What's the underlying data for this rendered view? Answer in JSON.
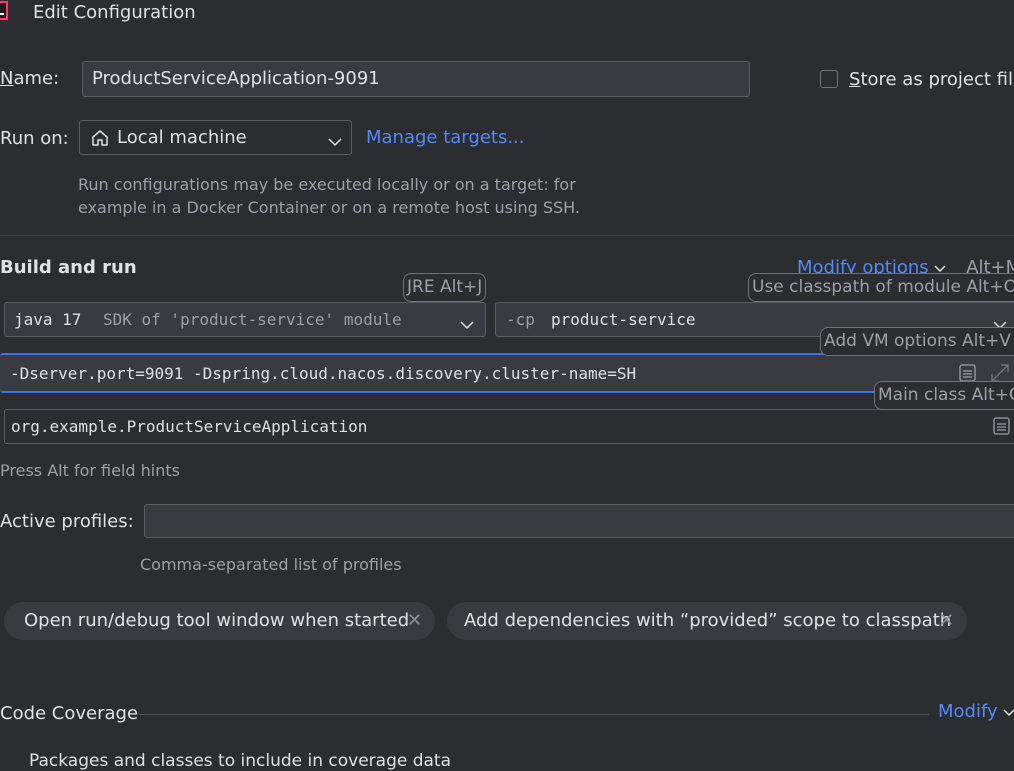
{
  "window": {
    "title": "Edit Configuration",
    "app_icon": "intellij-icon"
  },
  "name_row": {
    "label_mnemonic": "N",
    "label_rest": "ame:",
    "value": "ProductServiceApplication-9091"
  },
  "store_project": {
    "label_mnemonic": "S",
    "label_rest": "tore as project file",
    "checked": false
  },
  "run_on": {
    "label": "Run on:",
    "target": "Local machine",
    "target_icon": "home-icon",
    "manage_link": "Manage targets..."
  },
  "run_on_help": {
    "line1": "Run configurations may be executed locally or on a target: for",
    "line2": "example in a Docker Container or on a remote host using SSH."
  },
  "build_run": {
    "header": "Build and run",
    "modify_options": "Modify options",
    "modify_options_shortcut": "Alt+M",
    "jre_hint": "JRE Alt+J",
    "classpath_hint": "Use classpath of module Alt+O",
    "vm_hint": "Add VM options Alt+V",
    "main_class_hint": "Main class Alt+C",
    "jre": {
      "version": "java 17",
      "desc": "SDK of 'product-service' module"
    },
    "classpath": {
      "flag": "-cp",
      "module": "product-service"
    },
    "vm_options": "-Dserver.port=9091 -Dspring.cloud.nacos.discovery.cluster-name=SH",
    "main_class": "org.example.ProductServiceApplication",
    "field_hint": "Press Alt for field hints"
  },
  "profiles": {
    "label": "Active profiles:",
    "value": "",
    "help": "Comma-separated list of profiles"
  },
  "chips": [
    {
      "label": "Open run/debug tool window when started"
    },
    {
      "label": "Add dependencies with “provided” scope to classpath"
    }
  ],
  "code_coverage": {
    "label": "Code Coverage",
    "modify": "Modify",
    "subtext": "Packages and classes to include in coverage data"
  },
  "colors": {
    "background": "#2b2d30",
    "accent": "#548af7",
    "field": "#393b40",
    "focus_border": "#3574f0"
  }
}
